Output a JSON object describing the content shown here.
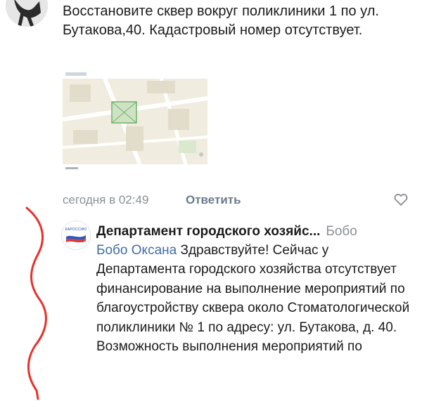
{
  "post": {
    "text": "Восстановите сквер вокруг поликлиники 1 по ул. Бутакова,40. Кадастровый номер отсутствует.",
    "time": "сегодня в 02:49",
    "reply_label": "Ответить"
  },
  "reply": {
    "author": "Департамент городского хозяйс...",
    "reply_to": "Бобо",
    "mention": "Бобо Оксана",
    "text": "Здравствуйте! Сейчас у Департамента городского хозяйства отсутствует финансирование на выполнение мероприятий по благоустройству сквера около Стоматологической поликлиники № 1 по адресу: ул. Бутакова, д. 40. Возможность выполнения мероприятий по",
    "avatar_text": "КАРОССИЮ"
  },
  "icons": [
    "like-icon",
    "user-avatar",
    "department-logo"
  ],
  "colors": {
    "link": "#3f6ea6",
    "muted": "#8a8f95",
    "annotation": "#e8312a"
  }
}
